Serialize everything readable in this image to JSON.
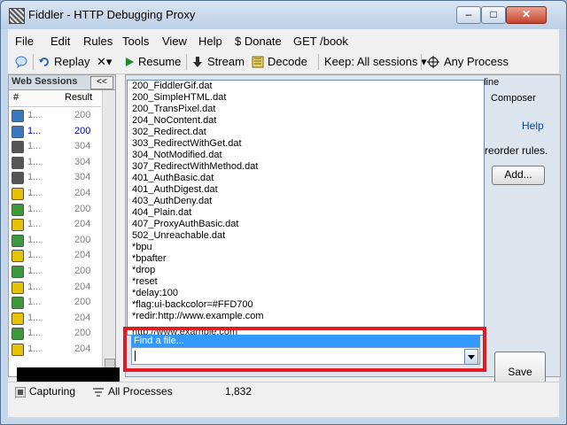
{
  "window": {
    "title": "Fiddler - HTTP Debugging Proxy",
    "controls": {
      "minimize": "–",
      "maximize": "□",
      "close": "✕"
    }
  },
  "menu": [
    "File",
    "Edit",
    "Rules",
    "Tools",
    "View",
    "Help",
    "$ Donate",
    "GET /book"
  ],
  "toolbar": {
    "replay": "Replay",
    "remove": "✕▾",
    "resume": "Resume",
    "stream": "Stream",
    "decode": "Decode",
    "keep": "Keep: All sessions ▾",
    "process": "Any Process"
  },
  "sessions": {
    "header": "Web Sessions",
    "collapse": "<<",
    "col_num": "#",
    "col_result": "Result",
    "rows": [
      {
        "num": "1...",
        "result": "200"
      },
      {
        "num": "1...",
        "result": "200"
      },
      {
        "num": "1...",
        "result": "304"
      },
      {
        "num": "1...",
        "result": "304"
      },
      {
        "num": "1...",
        "result": "304"
      },
      {
        "num": "1...",
        "result": "204"
      },
      {
        "num": "1...",
        "result": "200"
      },
      {
        "num": "1...",
        "result": "204"
      },
      {
        "num": "1...",
        "result": "200"
      },
      {
        "num": "1...",
        "result": "204"
      },
      {
        "num": "1...",
        "result": "200"
      },
      {
        "num": "1...",
        "result": "204"
      },
      {
        "num": "1...",
        "result": "200"
      },
      {
        "num": "1...",
        "result": "204"
      },
      {
        "num": "1...",
        "result": "200"
      },
      {
        "num": "1...",
        "result": "204"
      }
    ],
    "selected_index": 1
  },
  "right_panel": {
    "tab_line": "eline",
    "tab_composer": "Composer",
    "help": "Help",
    "reorder": "reorder rules.",
    "add": "Add...",
    "save": "Save"
  },
  "dropdown": {
    "options": [
      "200_FiddlerGif.dat",
      "200_SimpleHTML.dat",
      "200_TransPixel.dat",
      "204_NoContent.dat",
      "302_Redirect.dat",
      "303_RedirectWithGet.dat",
      "304_NotModified.dat",
      "307_RedirectWithMethod.dat",
      "401_AuthBasic.dat",
      "401_AuthDigest.dat",
      "403_AuthDeny.dat",
      "404_Plain.dat",
      "407_ProxyAuthBasic.dat",
      "502_Unreachable.dat",
      "*bpu",
      "*bpafter",
      "*drop",
      "*reset",
      "*delay:100",
      "*flag:ui-backcolor=#FFD700",
      "*redir:http://www.example.com"
    ],
    "partial_option": "http://www.example.com",
    "highlighted_option": "Find a file...",
    "combo_value": ""
  },
  "statusbar": {
    "capturing": "Capturing",
    "processes": "All Processes",
    "count": "1,832"
  },
  "colors": {
    "highlight_border": "#e01b24",
    "selected_option": "#3399ff",
    "title_bg": "#c6d7ea"
  }
}
